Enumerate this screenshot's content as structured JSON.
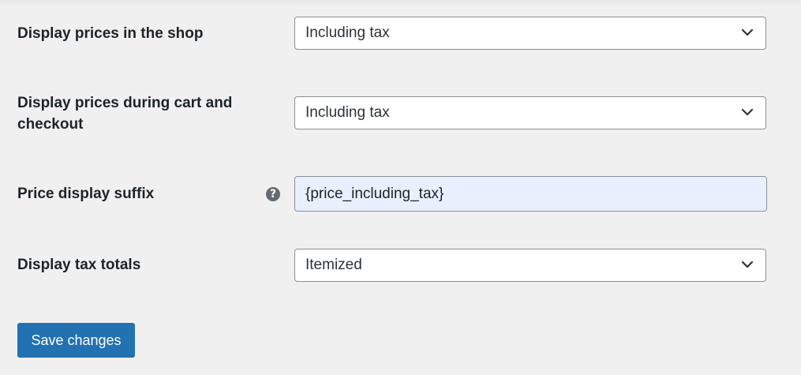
{
  "settings": [
    {
      "label": "Display prices in the shop",
      "type": "select",
      "value": "Including tax"
    },
    {
      "label": "Display prices during cart and checkout",
      "type": "select",
      "value": "Including tax"
    },
    {
      "label": "Price display suffix",
      "type": "text",
      "value": "{price_including_tax}",
      "help_icon": "question-circle-icon",
      "help_symbol": "?"
    },
    {
      "label": "Display tax totals",
      "type": "select",
      "value": "Itemized"
    }
  ],
  "footer": {
    "save_label": "Save changes"
  },
  "colors": {
    "background": "#f0f0f1",
    "primary_button": "#2271b1",
    "autofill_input": "#e8f0fe",
    "border": "#8c8f94"
  }
}
